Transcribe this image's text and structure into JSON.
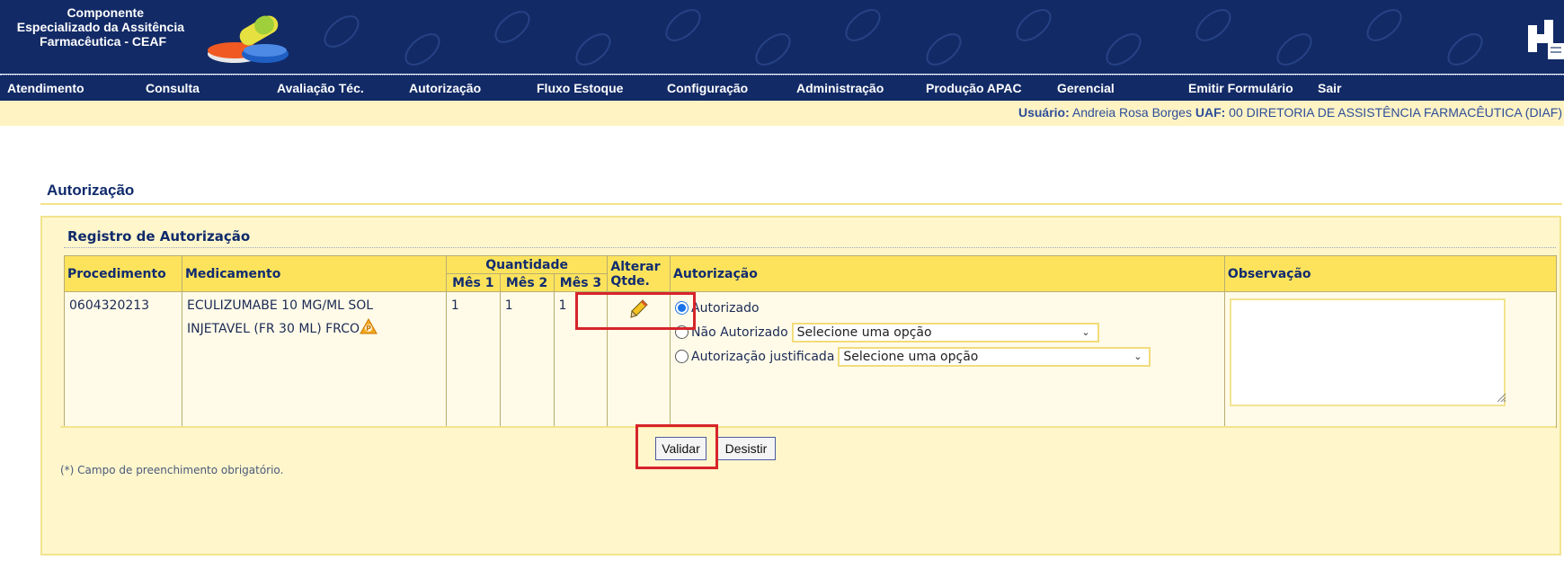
{
  "header": {
    "brand_line1": "Componente",
    "brand_line2": "Especializado da Assitência",
    "brand_line3": "Farmacêutica - CEAF",
    "colors": {
      "banner": "#122a66",
      "accent": "#fde35c",
      "highlight": "#d7242a"
    }
  },
  "menu": {
    "items": [
      "Atendimento",
      "Consulta",
      "Avaliação Téc.",
      "Autorização",
      "Fluxo Estoque",
      "Configuração",
      "Administração",
      "Produção APAC",
      "Gerencial",
      "Emitir Formulário",
      "Sair"
    ]
  },
  "user": {
    "user_label": "Usuário:",
    "user_name": "Andreia Rosa Borges",
    "uaf_label": "UAF:",
    "uaf_value": "00 DIRETORIA DE ASSISTÊNCIA FARMACÊUTICA (DIAF)"
  },
  "page": {
    "title": "Autorização"
  },
  "section": {
    "title": "Registro de Autorização"
  },
  "table": {
    "headers": {
      "procedimento": "Procedimento",
      "medicamento": "Medicamento",
      "quantidade": "Quantidade",
      "mes1": "Mês 1",
      "mes2": "Mês 2",
      "mes3": "Mês 3",
      "alterar_line1": "Alterar",
      "alterar_line2": "Qtde.",
      "autorizacao": "Autorização",
      "observacao": "Observação"
    },
    "row": {
      "procedimento": "0604320213",
      "medicamento_line1": "ECULIZUMABE 10 MG/ML SOL",
      "medicamento_line2": "INJETAVEL (FR 30 ML) FRCO",
      "mes1": "1",
      "mes2": "1",
      "mes3": "1",
      "edit_icon": "pencil-icon",
      "warning_icon": "warning-icon"
    }
  },
  "authorization": {
    "selected": "autorizado",
    "options": {
      "autorizado": "Autorizado",
      "nao_autorizado": "Não Autorizado",
      "justificada": "Autorização justificada"
    },
    "nao_autorizado_select": "Selecione uma opção",
    "justificada_select": "Selecione uma opção"
  },
  "observation": {
    "value": ""
  },
  "buttons": {
    "validar": "Validar",
    "desistir": "Desistir"
  },
  "footnote": "(*) Campo de preenchimento obrigatório."
}
